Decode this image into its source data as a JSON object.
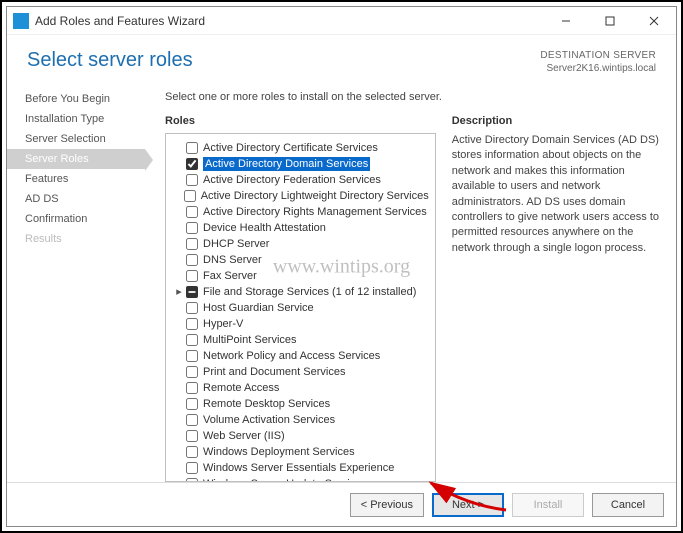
{
  "window": {
    "title": "Add Roles and Features Wizard"
  },
  "header": {
    "title": "Select server roles",
    "destination_label": "DESTINATION SERVER",
    "destination_value": "Server2K16.wintips.local"
  },
  "nav": {
    "items": [
      {
        "label": "Before You Begin",
        "state": "normal"
      },
      {
        "label": "Installation Type",
        "state": "normal"
      },
      {
        "label": "Server Selection",
        "state": "normal"
      },
      {
        "label": "Server Roles",
        "state": "active"
      },
      {
        "label": "Features",
        "state": "normal"
      },
      {
        "label": "AD DS",
        "state": "normal"
      },
      {
        "label": "Confirmation",
        "state": "normal"
      },
      {
        "label": "Results",
        "state": "disabled"
      }
    ]
  },
  "content": {
    "instruction": "Select one or more roles to install on the selected server.",
    "roles_label": "Roles",
    "description_label": "Description",
    "description_text": "Active Directory Domain Services (AD DS) stores information about objects on the network and makes this information available to users and network administrators. AD DS uses domain controllers to give network users access to permitted resources anywhere on the network through a single logon process.",
    "roles": [
      {
        "label": "Active Directory Certificate Services",
        "checked": false,
        "selected": false,
        "expandable": false,
        "expander": ""
      },
      {
        "label": "Active Directory Domain Services",
        "checked": true,
        "selected": true,
        "expandable": false,
        "expander": ""
      },
      {
        "label": "Active Directory Federation Services",
        "checked": false,
        "selected": false,
        "expandable": false,
        "expander": ""
      },
      {
        "label": "Active Directory Lightweight Directory Services",
        "checked": false,
        "selected": false,
        "expandable": false,
        "expander": ""
      },
      {
        "label": "Active Directory Rights Management Services",
        "checked": false,
        "selected": false,
        "expandable": false,
        "expander": ""
      },
      {
        "label": "Device Health Attestation",
        "checked": false,
        "selected": false,
        "expandable": false,
        "expander": ""
      },
      {
        "label": "DHCP Server",
        "checked": false,
        "selected": false,
        "expandable": false,
        "expander": ""
      },
      {
        "label": "DNS Server",
        "checked": false,
        "selected": false,
        "expandable": false,
        "expander": ""
      },
      {
        "label": "Fax Server",
        "checked": false,
        "selected": false,
        "expandable": false,
        "expander": ""
      },
      {
        "label": "File and Storage Services (1 of 12 installed)",
        "checked": true,
        "selected": false,
        "expandable": true,
        "expander": "▸",
        "indeterminate": true
      },
      {
        "label": "Host Guardian Service",
        "checked": false,
        "selected": false,
        "expandable": false,
        "expander": ""
      },
      {
        "label": "Hyper-V",
        "checked": false,
        "selected": false,
        "expandable": false,
        "expander": ""
      },
      {
        "label": "MultiPoint Services",
        "checked": false,
        "selected": false,
        "expandable": false,
        "expander": ""
      },
      {
        "label": "Network Policy and Access Services",
        "checked": false,
        "selected": false,
        "expandable": false,
        "expander": ""
      },
      {
        "label": "Print and Document Services",
        "checked": false,
        "selected": false,
        "expandable": false,
        "expander": ""
      },
      {
        "label": "Remote Access",
        "checked": false,
        "selected": false,
        "expandable": false,
        "expander": ""
      },
      {
        "label": "Remote Desktop Services",
        "checked": false,
        "selected": false,
        "expandable": false,
        "expander": ""
      },
      {
        "label": "Volume Activation Services",
        "checked": false,
        "selected": false,
        "expandable": false,
        "expander": ""
      },
      {
        "label": "Web Server (IIS)",
        "checked": false,
        "selected": false,
        "expandable": false,
        "expander": ""
      },
      {
        "label": "Windows Deployment Services",
        "checked": false,
        "selected": false,
        "expandable": false,
        "expander": ""
      },
      {
        "label": "Windows Server Essentials Experience",
        "checked": false,
        "selected": false,
        "expandable": false,
        "expander": ""
      },
      {
        "label": "Windows Server Update Services",
        "checked": false,
        "selected": false,
        "expandable": false,
        "expander": ""
      }
    ]
  },
  "footer": {
    "previous": "< Previous",
    "next": "Next >",
    "install": "Install",
    "cancel": "Cancel"
  },
  "watermark": "www.wintips.org"
}
